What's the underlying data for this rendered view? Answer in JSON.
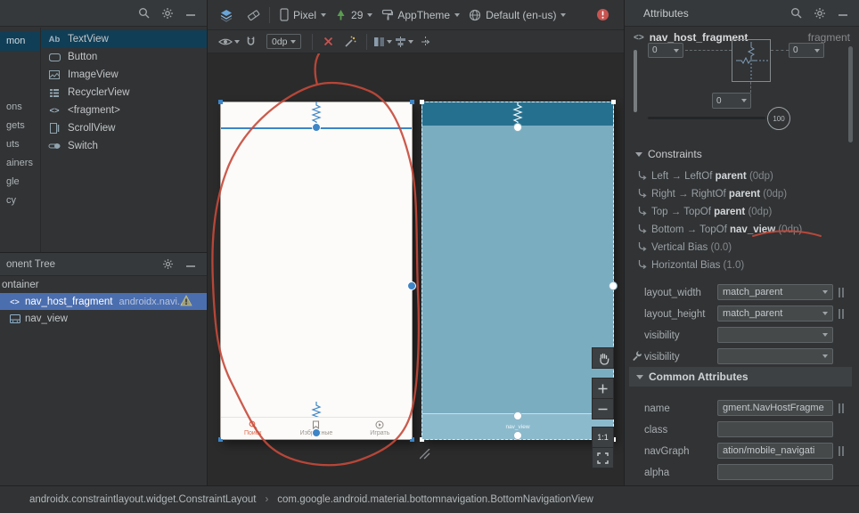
{
  "icons": {
    "code_glyph": "<>"
  },
  "palette": {
    "categories": [
      "mon",
      "ons",
      "gets",
      "uts",
      "ainers",
      "gle",
      "cy"
    ],
    "items": [
      {
        "glyph": "Ab",
        "label": "TextView"
      },
      {
        "label": "Button"
      },
      {
        "label": "ImageView"
      },
      {
        "label": "RecyclerView"
      },
      {
        "glyph": "<>",
        "label": "<fragment>"
      },
      {
        "label": "ScrollView"
      },
      {
        "label": "Switch"
      }
    ]
  },
  "component_tree": {
    "title": "onent Tree",
    "items": [
      {
        "label": "ontainer"
      },
      {
        "label": "nav_host_fragment",
        "detail": "androidx.navi..."
      },
      {
        "label": "nav_view"
      }
    ]
  },
  "toolbar": {
    "device": "Pixel",
    "api": "29",
    "theme": "AppTheme",
    "locale": "Default (en-us)",
    "margin": "0dp"
  },
  "zoom": {
    "actual": "1:1"
  },
  "design": {
    "bottom_nav": [
      {
        "label": "Поиск"
      },
      {
        "label": "Избранные"
      },
      {
        "label": "Играть"
      }
    ],
    "blueprint_label": "nav_view"
  },
  "attributes": {
    "title": "Attributes",
    "component": "nav_host_fragment",
    "component_type": "fragment",
    "widget": {
      "margin_left": "0",
      "margin_right": "0",
      "margin_bottom": "0",
      "badge": "100"
    },
    "constraints_header": "Constraints",
    "constraints": [
      {
        "prefix": "Left → LeftOf ",
        "target": "parent",
        "suffix": " (0dp)"
      },
      {
        "prefix": "Right → RightOf ",
        "target": "parent",
        "suffix": " (0dp)"
      },
      {
        "prefix": "Top → TopOf ",
        "target": "parent",
        "suffix": " (0dp)"
      },
      {
        "prefix": "Bottom → TopOf ",
        "target": "nav_view",
        "suffix": " (0dp)"
      },
      {
        "prefix": "Vertical Bias ",
        "target": "",
        "suffix": "(0.0)"
      },
      {
        "prefix": "Horizontal Bias ",
        "target": "",
        "suffix": "(1.0)"
      }
    ],
    "fields": [
      {
        "label": "layout_width",
        "value": "match_parent"
      },
      {
        "label": "layout_height",
        "value": "match_parent"
      },
      {
        "label": "visibility",
        "value": ""
      },
      {
        "label": "visibility",
        "value": ""
      }
    ],
    "common_header": "Common Attributes",
    "common_fields": [
      {
        "label": "name",
        "value": "gment.NavHostFragme"
      },
      {
        "label": "class",
        "value": ""
      },
      {
        "label": "navGraph",
        "value": "ation/mobile_navigati"
      },
      {
        "label": "alpha",
        "value": ""
      }
    ]
  },
  "statusbar": {
    "left": "androidx.constraintlayout.widget.ConstraintLayout",
    "separator": "›",
    "right": "com.google.android.material.bottomnavigation.BottomNavigationView"
  }
}
